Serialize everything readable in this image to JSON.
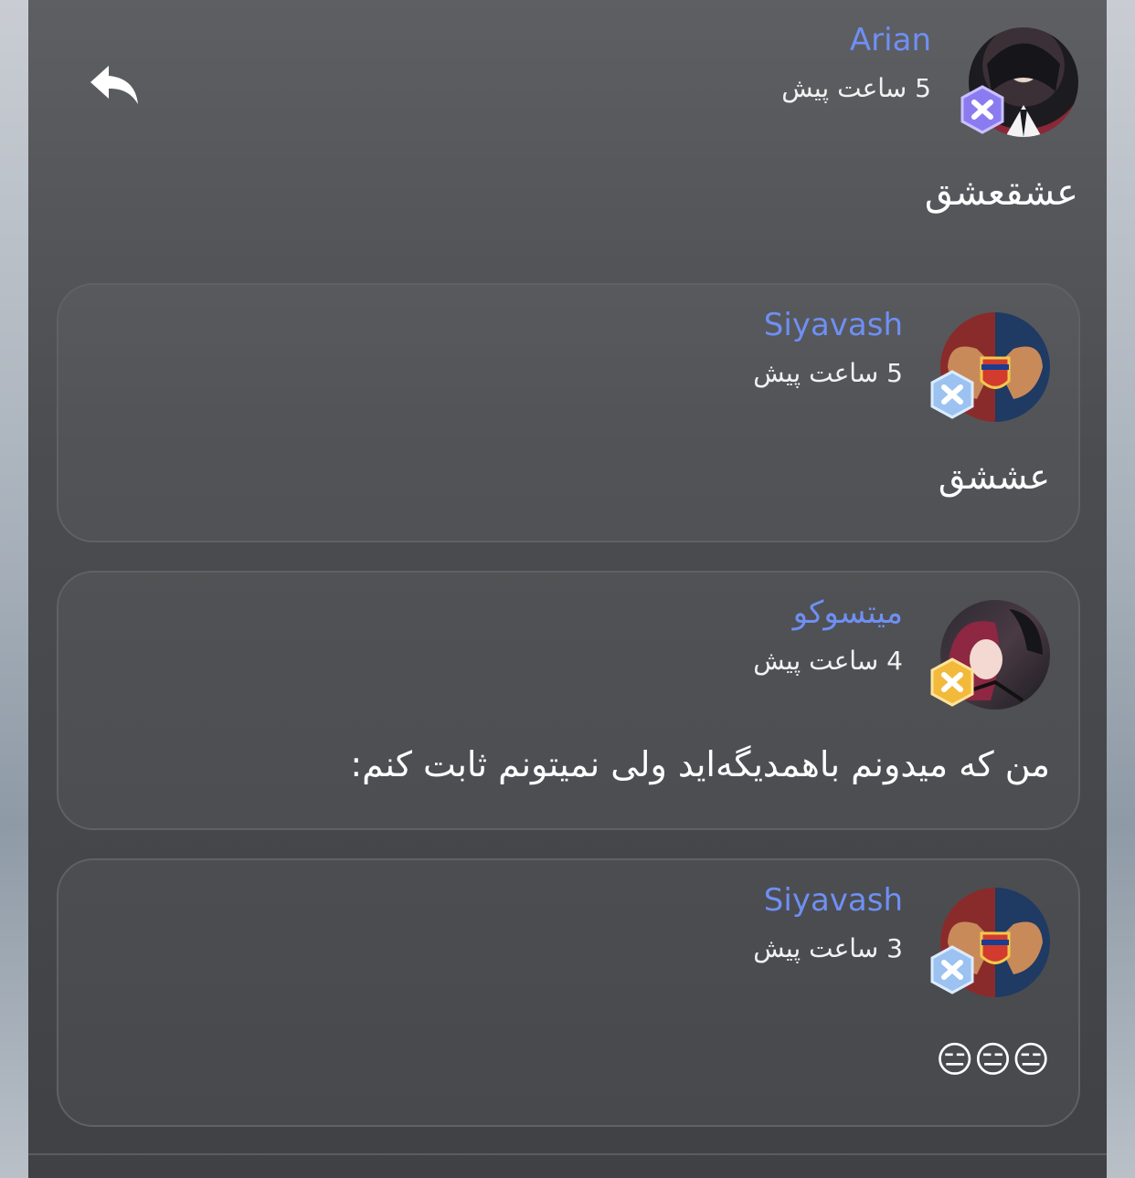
{
  "top_comment": {
    "author": "Arian",
    "time": "5 ساعت پیش",
    "text": "عشقعشق",
    "badge_color": "#8a7cf0",
    "name_color": "#6f8ff3"
  },
  "replies": [
    {
      "author": "Siyavash",
      "time": "5 ساعت پیش",
      "text": "عششق",
      "badge_color": "#9bc2f0",
      "avatar": "barcelona-heart-hands"
    },
    {
      "author": "میتسوکو",
      "time": "4 ساعت پیش",
      "text": "من که میدونم باهمدیگه‌اید ولی نمیتونم ثابت کنم:",
      "badge_color": "#f2b93a",
      "avatar": "anime-couple"
    },
    {
      "author": "Siyavash",
      "time": "3 ساعت پیش",
      "text": "😑😑😑",
      "badge_color": "#9bc2f0",
      "avatar": "barcelona-heart-hands"
    }
  ],
  "icons": {
    "reply": "reply-arrow-icon"
  }
}
